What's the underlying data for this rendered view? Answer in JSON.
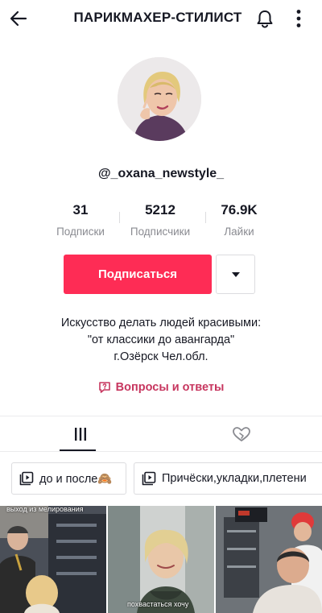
{
  "header": {
    "title": "ПАРИКМАХЕР-СТИЛИСТ",
    "back_icon": "arrow-left-icon",
    "bell_icon": "bell-icon",
    "more_icon": "more-vertical-icon"
  },
  "profile": {
    "username": "@_oxana_newstyle_",
    "avatar_icon": "avatar-photo"
  },
  "stats": [
    {
      "value": "31",
      "label": "Подписки"
    },
    {
      "value": "5212",
      "label": "Подписчики"
    },
    {
      "value": "76.9K",
      "label": "Лайки"
    }
  ],
  "actions": {
    "follow_label": "Подписаться",
    "dropdown_icon": "caret-down-icon"
  },
  "bio": {
    "line1": "Искусство делать людей красивыми:",
    "line2": "\"от классики до авангарда\"",
    "line3": "г.Озёрск Чел.обл."
  },
  "qa": {
    "label": "Вопросы и ответы",
    "icon": "question-bubble-icon"
  },
  "tabs": [
    {
      "icon": "grid-icon",
      "active": true
    },
    {
      "icon": "liked-heart-icon",
      "active": false
    }
  ],
  "playlists": [
    {
      "label": "до и после🙈",
      "icon": "playlist-icon"
    },
    {
      "label": "Причёски,укладки,плетени",
      "icon": "playlist-icon"
    }
  ],
  "videos": [
    {
      "caption": "выход из мелирования"
    },
    {
      "caption": "похвастаться хочу"
    },
    {
      "caption": ""
    }
  ],
  "colors": {
    "accent": "#fe2c55",
    "qa_link": "#c7365f",
    "secondary_text": "#8a8b91",
    "primary_text": "#161823",
    "border": "#dcdcdf"
  }
}
